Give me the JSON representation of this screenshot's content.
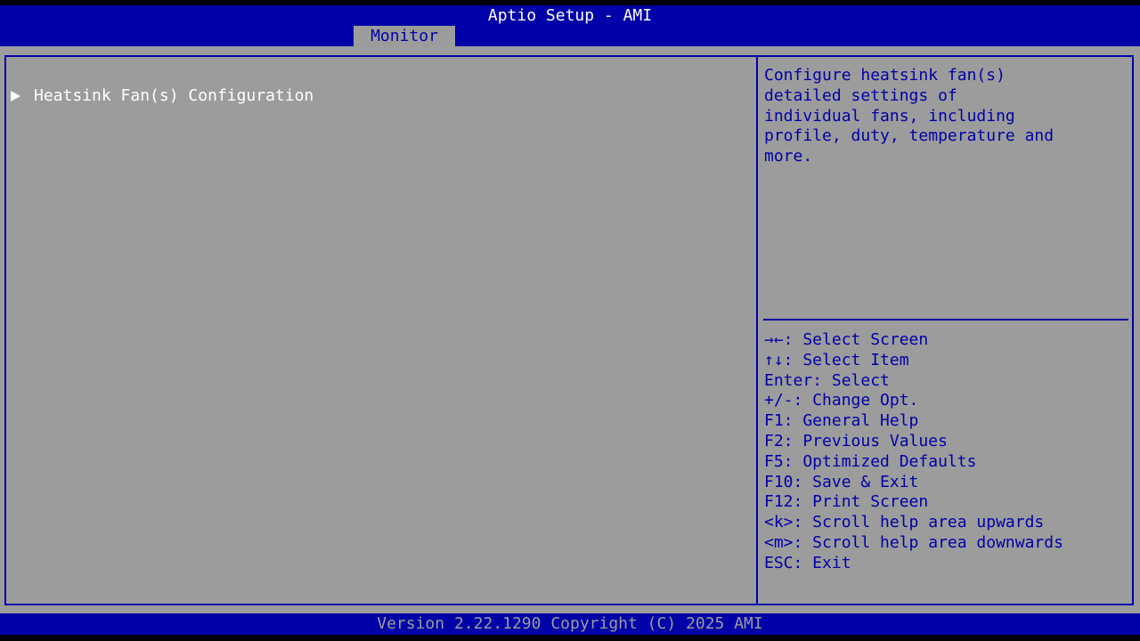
{
  "header": {
    "title": "Aptio Setup - AMI",
    "active_tab": "Monitor"
  },
  "menu": {
    "items": [
      {
        "label": "Heatsink Fan(s) Configuration",
        "icon": "right-triangle-icon",
        "type": "submenu"
      }
    ]
  },
  "help": {
    "description": "Configure heatsink fan(s)\ndetailed settings of\nindividual fans, including\nprofile, duty, temperature and\nmore."
  },
  "keys": [
    "→←: Select Screen",
    "↑↓: Select Item",
    "Enter: Select",
    "+/-: Change Opt.",
    "F1: General Help",
    "F2: Previous Values",
    "F5: Optimized Defaults",
    "F10: Save & Exit",
    "F12: Print Screen",
    "<k>: Scroll help area upwards",
    "<m>: Scroll help area downwards",
    "ESC: Exit"
  ],
  "footer": {
    "version": "Version 2.22.1290 Copyright (C) 2025 AMI"
  },
  "colors": {
    "header_bg": "#0000a8",
    "panel_bg": "#9c9c9c",
    "selected_text": "#ffffff",
    "help_text": "#0000a8"
  }
}
